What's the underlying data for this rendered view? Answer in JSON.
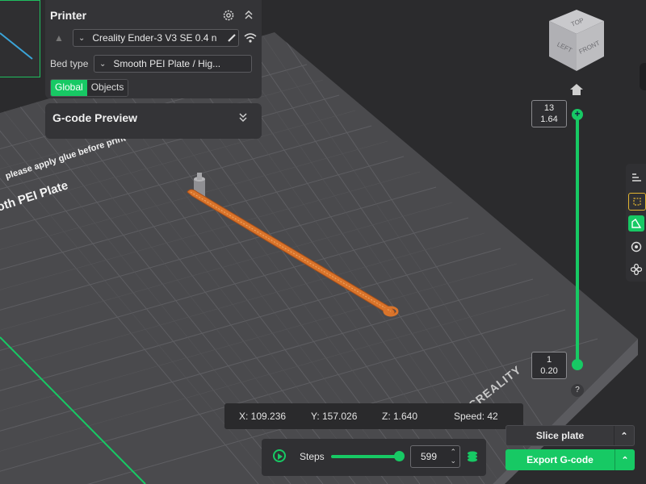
{
  "printer_panel": {
    "title": "Printer",
    "printer_select": "Creality Ender-3 V3 SE 0.4 n",
    "bed_type_label": "Bed type",
    "bed_type_select": "Smooth PEI Plate / Hig...",
    "tabs": [
      "Global",
      "Objects"
    ],
    "active_tab": "Global"
  },
  "gcode_panel": {
    "title": "G-code Preview"
  },
  "plate": {
    "note": "please apply glue before print",
    "name": "oth PEI Plate",
    "brand": "CREALITY"
  },
  "view_cube": {
    "top": "TOP",
    "left": "LEFT",
    "front": "FRONT"
  },
  "layer_slider": {
    "top_layer": "13",
    "top_height": "1.64",
    "bottom_layer": "1",
    "bottom_height": "0.20",
    "help": "?"
  },
  "readout": {
    "x": "X: 109.236",
    "y": "Y: 157.026",
    "z": "Z: 1.640",
    "speed": "Speed: 42"
  },
  "steps": {
    "label": "Steps",
    "value": "599"
  },
  "buttons": {
    "slice": "Slice plate",
    "export": "Export G-code"
  },
  "colors": {
    "accent": "#17c964",
    "toolpath": "#d9742b",
    "bed": "#4a4a4d",
    "background": "#2b2b2d"
  },
  "icons": [
    "settings-icon",
    "collapse-icon",
    "edit-icon",
    "wifi-icon",
    "home-icon",
    "play-icon",
    "layers-icon",
    "chevron-down-icon"
  ]
}
